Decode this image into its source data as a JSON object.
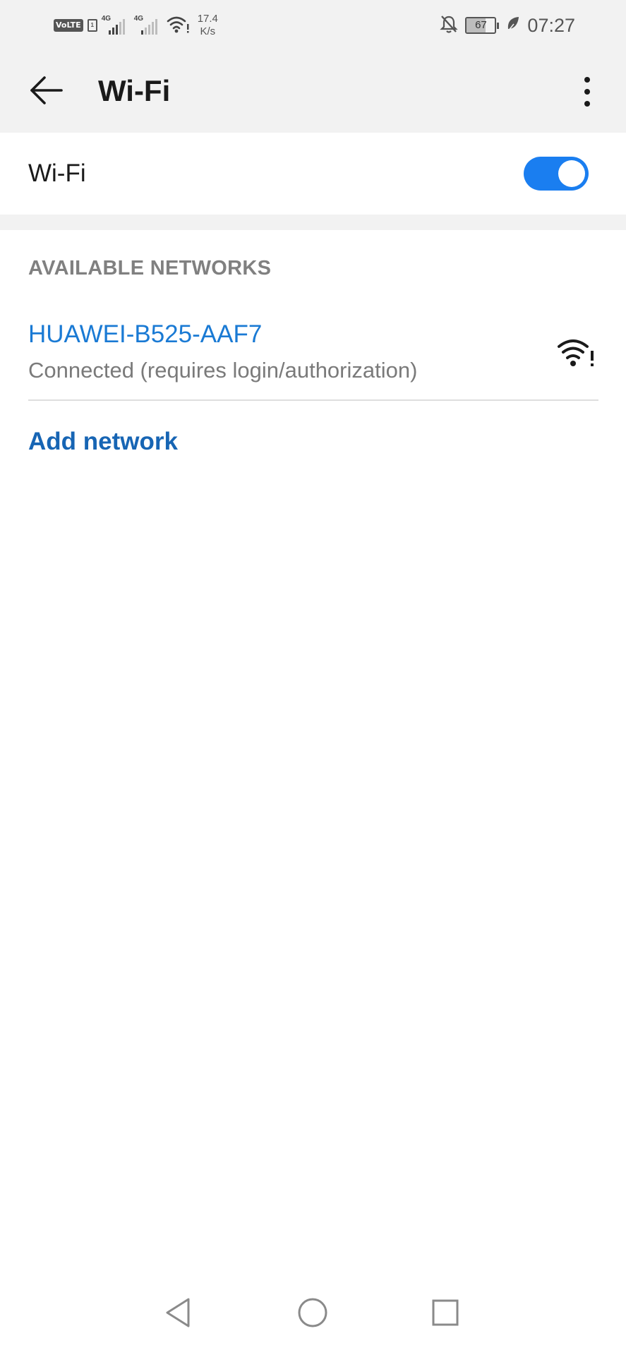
{
  "status_bar": {
    "volte": "VoLTE",
    "sim_indicator": "1",
    "net_type_1": "4G",
    "net_type_2": "4G",
    "speed_value": "17.4",
    "speed_unit": "K/s",
    "battery_level": "67",
    "time": "07:27",
    "icons": [
      "volte-icon",
      "signal-icon",
      "signal-icon",
      "wifi-alert-icon",
      "bell-off-icon",
      "battery-icon",
      "leaf-icon"
    ]
  },
  "app_bar": {
    "title": "Wi-Fi",
    "back_icon": "arrow-left-icon",
    "more_icon": "more-vertical-icon"
  },
  "wifi_toggle": {
    "label": "Wi-Fi",
    "enabled": true,
    "accent_color": "#1a7ef0"
  },
  "available_networks": {
    "header": "AVAILABLE NETWORKS",
    "items": [
      {
        "name": "HUAWEI-B525-AAF7",
        "status": "Connected (requires login/authorization)",
        "icon": "wifi-alert-icon"
      }
    ]
  },
  "add_network": {
    "label": "Add network"
  },
  "nav_bar": {
    "icons": [
      "back-triangle-icon",
      "home-circle-icon",
      "recents-square-icon"
    ]
  }
}
